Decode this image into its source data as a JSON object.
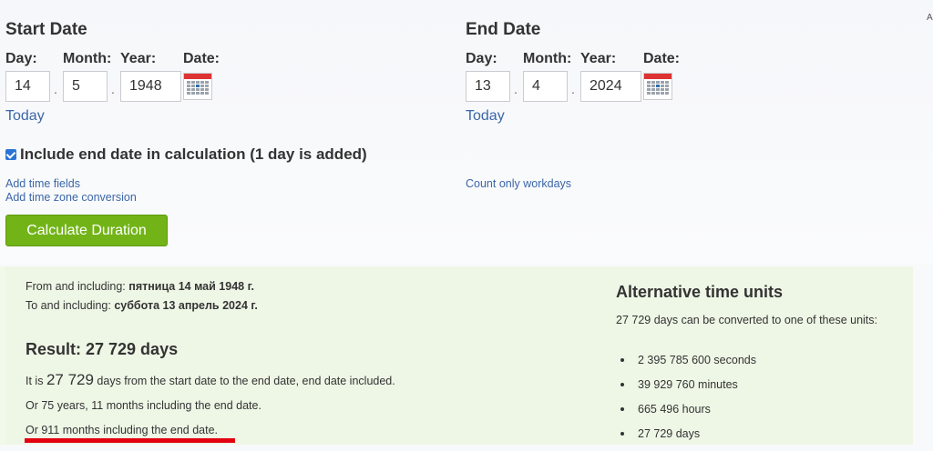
{
  "corner_char": "A",
  "start": {
    "heading": "Start Date",
    "day_label": "Day:",
    "month_label": "Month:",
    "year_label": "Year:",
    "date_label": "Date:",
    "day": "14",
    "month": "5",
    "year": "1948",
    "today_link": "Today"
  },
  "end": {
    "heading": "End Date",
    "day_label": "Day:",
    "month_label": "Month:",
    "year_label": "Year:",
    "date_label": "Date:",
    "day": "13",
    "month": "4",
    "year": "2024",
    "today_link": "Today"
  },
  "separator": ".",
  "include_end": {
    "checked": true,
    "label": "Include end date in calculation (1 day is added)"
  },
  "links": {
    "add_time": "Add time fields",
    "add_timezone": "Add time zone conversion",
    "workdays": "Count only workdays"
  },
  "calculate_button": "Calculate Duration",
  "result": {
    "from_prefix": "From and including:",
    "from_value": "пятница 14 май 1948 г.",
    "to_prefix": "To and including:",
    "to_value": "суббота 13 апрель 2024 г.",
    "title": "Result: 27 729 days",
    "line1_prefix": "It is",
    "line1_big": "27 729",
    "line1_suffix": "days from the start date to the end date, end date included.",
    "line2": "Or 75 years, 11 months including the end date.",
    "line3": "Or 911 months including the end date."
  },
  "alternative": {
    "title": "Alternative time units",
    "description": "27 729 days can be converted to one of these units:",
    "units": [
      "2 395 785 600 seconds",
      "39 929 760 minutes",
      "665 496 hours",
      "27 729 days"
    ]
  },
  "colors": {
    "button": "#72b418",
    "link": "#3b66a8",
    "panel": "#eef7e6",
    "highlight": "#e3000f"
  }
}
